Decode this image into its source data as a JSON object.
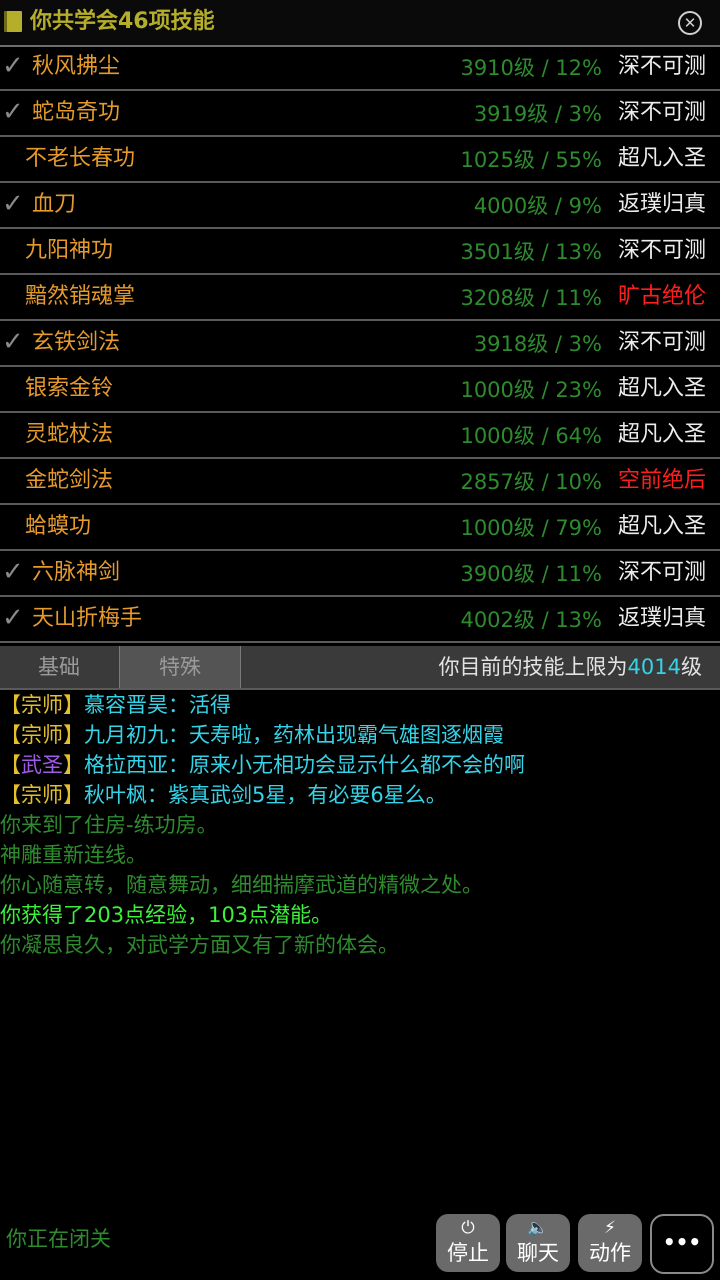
{
  "header": {
    "title": "你共学会46项技能",
    "close_icon": "close-icon",
    "book_icon": "book-icon"
  },
  "skills": [
    {
      "checked": true,
      "name": "秋风拂尘",
      "level": "3910级 / 12%",
      "rank": "深不可测",
      "rank_color": "white"
    },
    {
      "checked": true,
      "name": "蛇岛奇功",
      "level": "3919级 / 3%",
      "rank": "深不可测",
      "rank_color": "white"
    },
    {
      "checked": false,
      "name": "不老长春功",
      "level": "1025级 / 55%",
      "rank": "超凡入圣",
      "rank_color": "white"
    },
    {
      "checked": true,
      "name": "血刀",
      "level": "4000级 / 9%",
      "rank": "返璞归真",
      "rank_color": "white"
    },
    {
      "checked": false,
      "name": "九阳神功",
      "level": "3501级 / 13%",
      "rank": "深不可测",
      "rank_color": "white"
    },
    {
      "checked": false,
      "name": "黯然销魂掌",
      "level": "3208级 / 11%",
      "rank": "旷古绝伦",
      "rank_color": "red"
    },
    {
      "checked": true,
      "name": "玄铁剑法",
      "level": "3918级 / 3%",
      "rank": "深不可测",
      "rank_color": "white"
    },
    {
      "checked": false,
      "name": "银索金铃",
      "level": "1000级 / 23%",
      "rank": "超凡入圣",
      "rank_color": "white"
    },
    {
      "checked": false,
      "name": "灵蛇杖法",
      "level": "1000级 / 64%",
      "rank": "超凡入圣",
      "rank_color": "white"
    },
    {
      "checked": false,
      "name": "金蛇剑法",
      "level": "2857级 / 10%",
      "rank": "空前绝后",
      "rank_color": "red"
    },
    {
      "checked": false,
      "name": "蛤蟆功",
      "level": "1000级 / 79%",
      "rank": "超凡入圣",
      "rank_color": "white"
    },
    {
      "checked": true,
      "name": "六脉神剑",
      "level": "3900级 / 11%",
      "rank": "深不可测",
      "rank_color": "white"
    },
    {
      "checked": true,
      "name": "天山折梅手",
      "level": "4002级 / 13%",
      "rank": "返璞归真",
      "rank_color": "white"
    }
  ],
  "check_mark": "✓",
  "tabs": {
    "basic": "基础",
    "special": "特殊",
    "active": "special"
  },
  "limit": {
    "prefix": "你目前的技能上限为",
    "value": "4014",
    "suffix": "级"
  },
  "chat": [
    {
      "open": "【",
      "rank": "宗师",
      "close": "】",
      "rank_color": "yellow",
      "text": "慕容晋昊：活得"
    },
    {
      "open": "【",
      "rank": "宗师",
      "close": "】",
      "rank_color": "yellow",
      "text": "九月初九：夭寿啦，药林出现霸气雄图逐烟霞"
    },
    {
      "open": "【",
      "rank": "武圣",
      "close": "】",
      "rank_color": "purple",
      "text": "格拉西亚：原来小无相功会显示什么都不会的啊"
    },
    {
      "open": "【",
      "rank": "宗师",
      "close": "】",
      "rank_color": "yellow",
      "text": "秋叶枫：紫真武剑5星，有必要6星么。"
    }
  ],
  "system_log": [
    {
      "text": "你来到了住房-练功房。",
      "style": "dim"
    },
    {
      "text": "神雕重新连线。",
      "style": "dim"
    },
    {
      "text": "你心随意转，随意舞动，细细揣摩武道的精微之处。",
      "style": "dim"
    },
    {
      "text": "你获得了203点经验，103点潜能。",
      "style": "bright"
    },
    {
      "text": "你凝思良久，对武学方面又有了新的体会。",
      "style": "dim"
    }
  ],
  "status": "你正在闭关",
  "buttons": {
    "stop": {
      "icon": "power-icon",
      "glyph": "⏻",
      "label": "停止"
    },
    "chat": {
      "icon": "speaker-icon",
      "glyph": "🔈",
      "label": "聊天"
    },
    "action": {
      "icon": "lightning-icon",
      "glyph": "⚡",
      "label": "动作"
    },
    "more": {
      "icon": "more-icon",
      "glyph": "•••"
    }
  },
  "colors": {
    "skill_name": "#e59a2b",
    "level": "#2e8b2e",
    "rank_red": "#ff1e1e",
    "header_title": "#b5ae2b",
    "chat_text": "#35d3e8",
    "rank_yellow": "#e5c02b",
    "rank_purple": "#a05ae8"
  }
}
